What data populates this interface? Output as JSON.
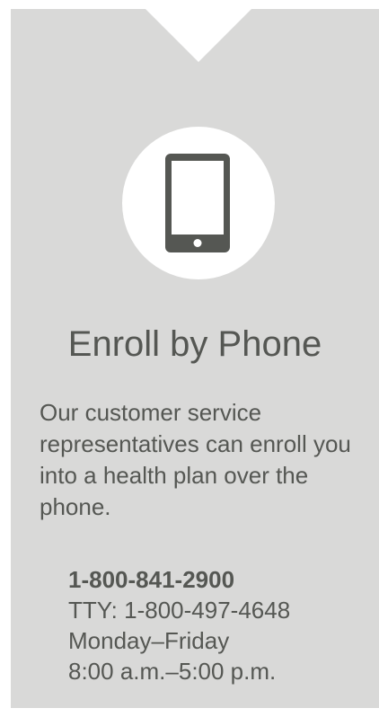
{
  "card": {
    "title": "Enroll by Phone",
    "description": "Our customer service representatives can enroll you into a health plan over the phone.",
    "icon": "smartphone-icon",
    "background_color": "#d9d9d8",
    "text_color": "#555753"
  },
  "contact": {
    "phone": "1-800-841-2900",
    "tty": "TTY: 1-800-497-4648",
    "days": "Monday–Friday",
    "hours": "8:00 a.m.–5:00 p.m."
  }
}
